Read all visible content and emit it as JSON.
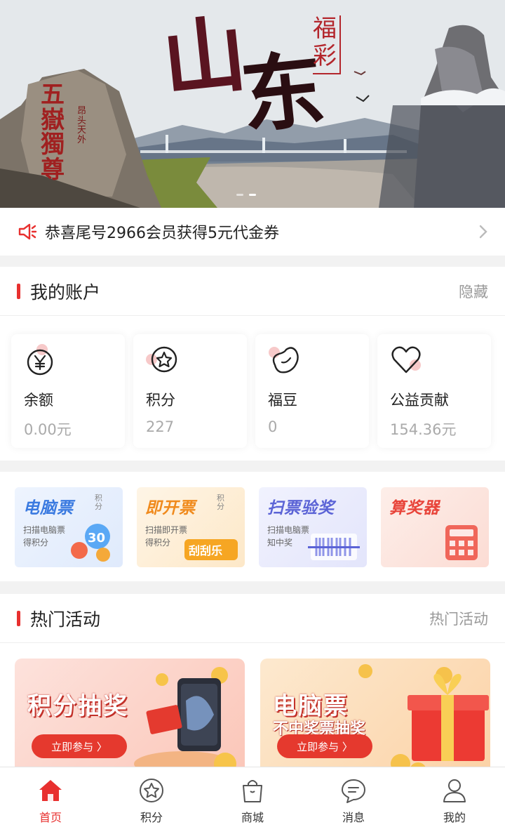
{
  "banner": {
    "title_chars": [
      "山",
      "东"
    ],
    "badge_chars": "福彩",
    "rock_text": "五嶽獨尊",
    "rock_sub": "昂头天外",
    "dot_count": 2,
    "active_dot": 0
  },
  "notice": {
    "text": "恭喜尾号2966会员获得5元代金券",
    "icon": "speaker-icon"
  },
  "account": {
    "title": "我的账户",
    "action": "隐藏",
    "items": [
      {
        "label": "余额",
        "value": "0.00元",
        "icon": "yuan-icon"
      },
      {
        "label": "积分",
        "value": "227",
        "icon": "star-icon"
      },
      {
        "label": "福豆",
        "value": "0",
        "icon": "bean-icon"
      },
      {
        "label": "公益贡献",
        "value": "154.36元",
        "icon": "heart-icon"
      }
    ]
  },
  "tools": [
    {
      "title": "电脑票",
      "tag": "积分",
      "sub": "扫描电脑票得积分",
      "color": "#3a7ae0",
      "bg": "#e9f1fd"
    },
    {
      "title": "即开票",
      "tag": "积分",
      "sub": "扫描即开票得积分",
      "color": "#f08a1c",
      "bg": "#fdf1df"
    },
    {
      "title": "扫票验奖",
      "tag": "",
      "sub": "扫描电脑票知中奖",
      "color": "#5b63d6",
      "bg": "#eeeffd"
    },
    {
      "title": "算奖器",
      "tag": "",
      "sub": "",
      "color": "#e8443a",
      "bg": "#fde8e4"
    }
  ],
  "hot": {
    "title": "热门活动",
    "action": "热门活动",
    "cards": [
      {
        "title": "积分抽奖",
        "sub": "",
        "button": "立即参与 〉"
      },
      {
        "title": "电脑票",
        "sub": "不中奖票抽奖",
        "button": "立即参与 〉"
      }
    ]
  },
  "tabbar": [
    {
      "label": "首页",
      "icon": "home-icon",
      "active": true
    },
    {
      "label": "积分",
      "icon": "star-icon",
      "active": false
    },
    {
      "label": "商城",
      "icon": "shopping-bag-icon",
      "active": false
    },
    {
      "label": "消息",
      "icon": "message-icon",
      "active": false
    },
    {
      "label": "我的",
      "icon": "user-icon",
      "active": false
    }
  ],
  "colors": {
    "accent": "#e8302f",
    "muted": "#999999"
  }
}
